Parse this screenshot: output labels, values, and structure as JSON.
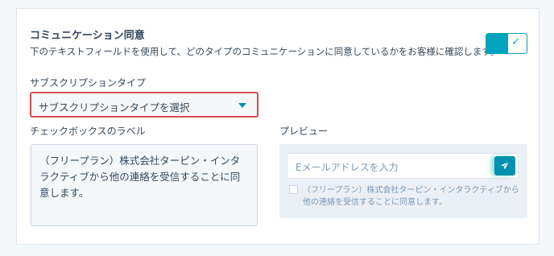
{
  "section": {
    "title": "コミュニケーション同意",
    "description": "下のテキストフィールドを使用して、どのタイプのコミュニケーションに同意しているかをお客様に確認します。"
  },
  "toggle": {
    "state": "on",
    "icon": "checkmark-icon",
    "accent_color": "#00a4bd"
  },
  "subscription": {
    "label": "サブスクリプションタイプ",
    "selected": "サブスクリプションタイプを選択",
    "error_color": "#d94c53"
  },
  "checkbox_label": {
    "label": "チェックボックスのラベル",
    "value": "（フリープラン）株式会社ターピン・インタラクティブから他の連絡を受信することに同意します。"
  },
  "preview": {
    "label": "プレビュー",
    "email_placeholder": "Eメールアドレスを入力",
    "send_icon": "paper-plane-icon",
    "consent_text": "（フリープラン）株式会社ターピン・インタラクティブから他の連絡を受信することに同意します。"
  }
}
